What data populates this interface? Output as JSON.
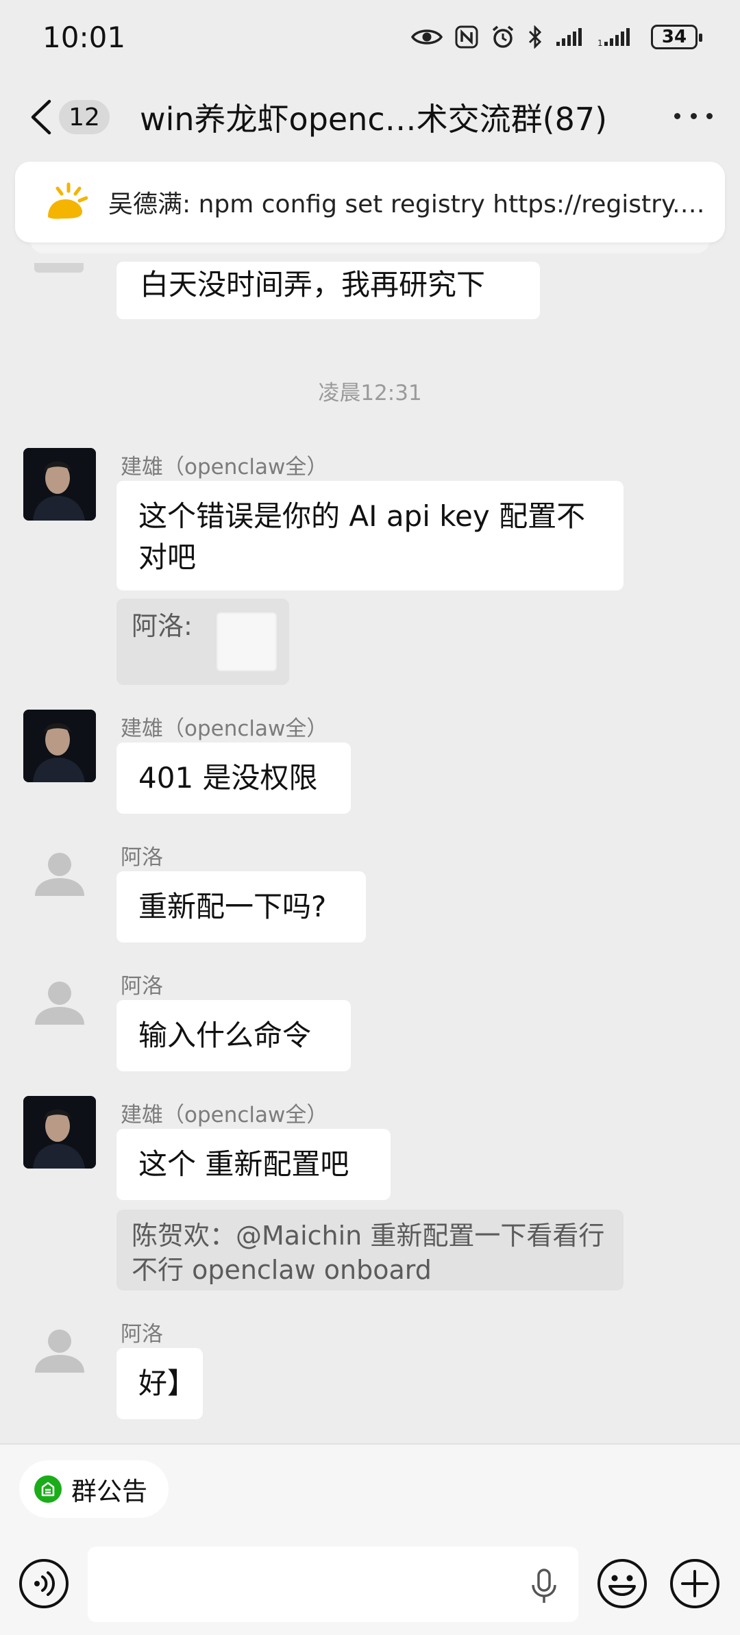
{
  "status_bar": {
    "time": "10:01",
    "battery": "34",
    "icons": [
      "eye-icon",
      "nfc-icon",
      "alarm-icon",
      "bluetooth-icon",
      "signal-icon",
      "signal-2-icon",
      "battery-icon"
    ]
  },
  "nav": {
    "unread_count": "12",
    "title": "win养龙虾openc…术交流群(87)",
    "icons": [
      "back-icon",
      "more-icon"
    ]
  },
  "pinned": {
    "text": "吴德满: npm config set registry https://registry.…",
    "icon": "pinned-bulb-icon",
    "accent_color": "#f5b400"
  },
  "messages": {
    "m0": {
      "text": "白天没时间弄，我再研究下"
    },
    "divider_time": "凌晨12:31",
    "m1": {
      "sender": "建雄（openclaw全）",
      "line1": "这个错误是你的 AI api key 配置不",
      "line2": "对吧"
    },
    "m1_quote": {
      "text": "阿洛:"
    },
    "m2": {
      "sender": "建雄（openclaw全）",
      "text": "401 是没权限"
    },
    "m3": {
      "sender": "阿洛",
      "text": "重新配一下吗?"
    },
    "m4": {
      "sender": "阿洛",
      "text": "输入什么命令"
    },
    "m5": {
      "sender": "建雄（openclaw全）",
      "text": "这个 重新配置吧"
    },
    "m5_quote": {
      "line1": "陈贺欢：@Maichin 重新配置一下看看行",
      "line2": "不行 openclaw onboard"
    },
    "m6": {
      "sender": "阿洛",
      "text": "好】"
    }
  },
  "bottom": {
    "notice_label": "群公告",
    "notice_icon_color": "#1aad19",
    "icons": [
      "voice-icon",
      "mic-icon",
      "emoji-icon",
      "plus-icon"
    ]
  }
}
